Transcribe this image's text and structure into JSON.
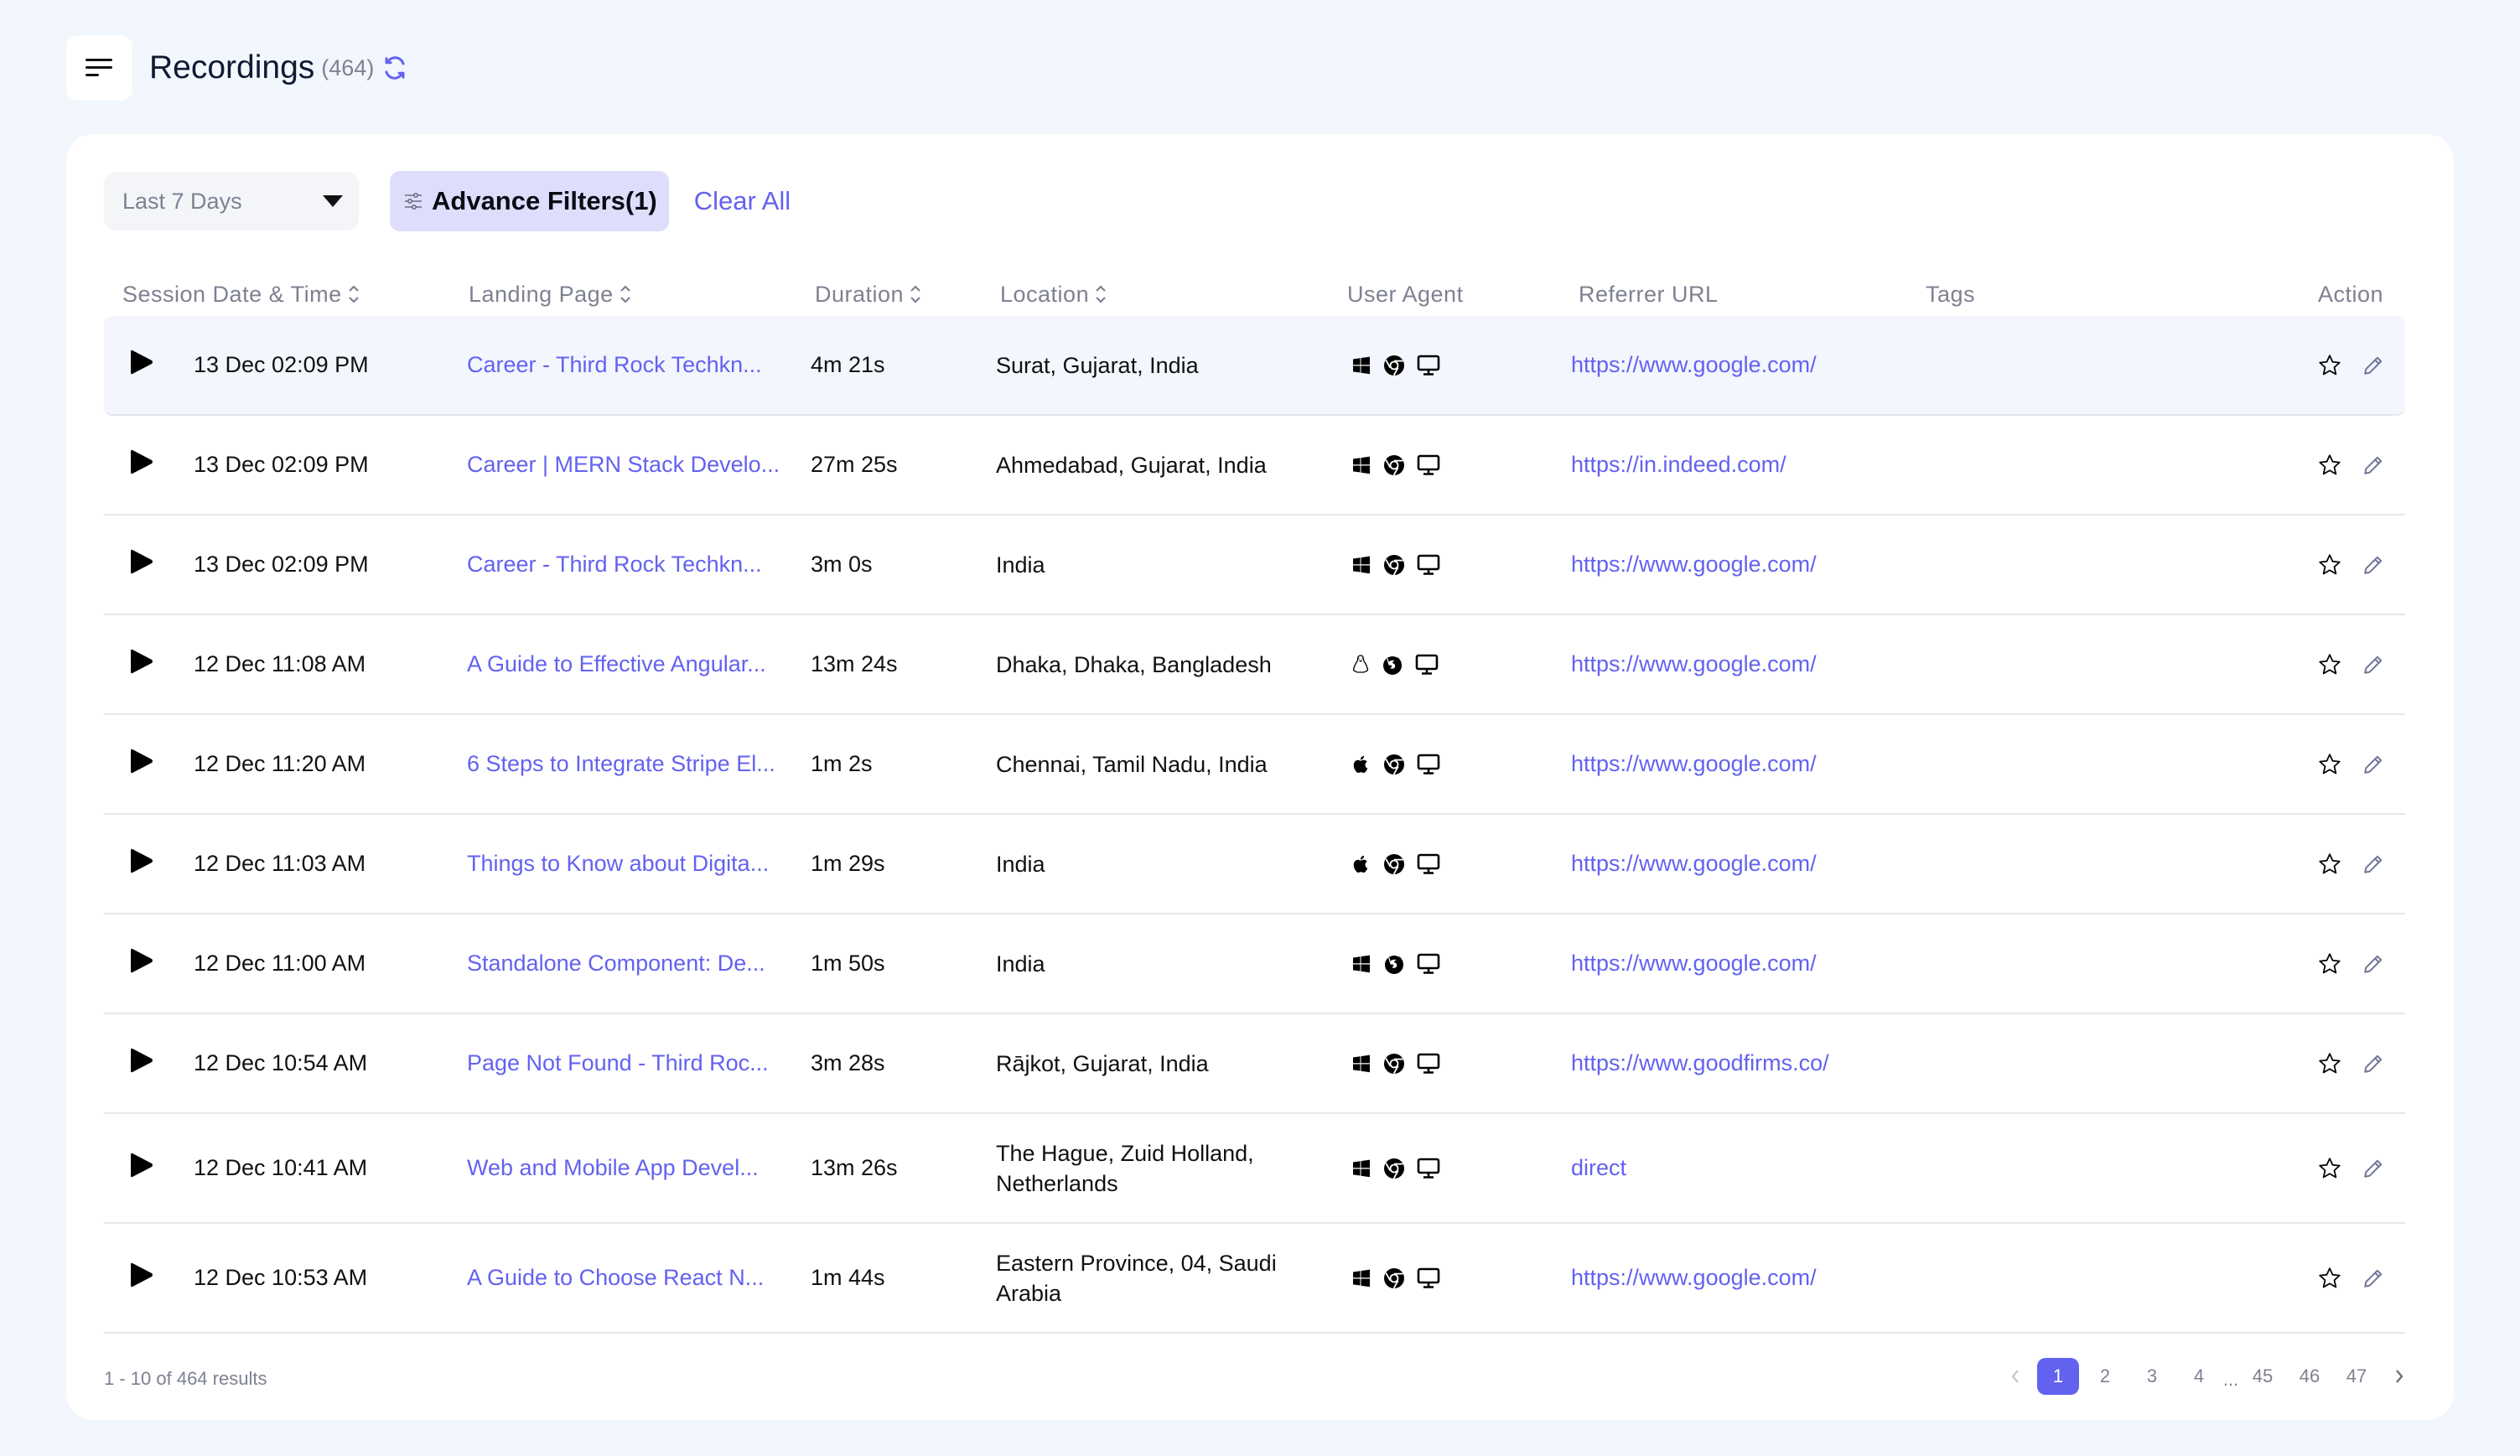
{
  "header": {
    "title": "Recordings",
    "count": "(464)"
  },
  "filters": {
    "date_range": "Last 7 Days",
    "advance_filters": "Advance Filters(1)",
    "clear_all": "Clear All"
  },
  "table": {
    "columns": [
      {
        "label": "Session Date & Time",
        "sortable": true
      },
      {
        "label": "Landing Page",
        "sortable": true
      },
      {
        "label": "Duration",
        "sortable": true
      },
      {
        "label": "Location",
        "sortable": true
      },
      {
        "label": "User Agent",
        "sortable": false
      },
      {
        "label": "Referrer URL",
        "sortable": false
      },
      {
        "label": "Tags",
        "sortable": false
      },
      {
        "label": "Action",
        "sortable": false
      }
    ],
    "rows": [
      {
        "date": "13 Dec 02:09 PM",
        "landing": "Career - Third Rock Techkn...",
        "duration": "4m 21s",
        "location": "Surat, Gujarat, India",
        "os": "windows",
        "browser": "chrome",
        "device": "desktop",
        "referrer": "https://www.google.com/"
      },
      {
        "date": "13 Dec 02:09 PM",
        "landing": "Career | MERN Stack Develo...",
        "duration": "27m 25s",
        "location": "Ahmedabad, Gujarat, India",
        "os": "windows",
        "browser": "chrome",
        "device": "desktop",
        "referrer": "https://in.indeed.com/"
      },
      {
        "date": "13 Dec 02:09 PM",
        "landing": "Career - Third Rock Techkn...",
        "duration": "3m 0s",
        "location": "India",
        "os": "windows",
        "browser": "chrome",
        "device": "desktop",
        "referrer": "https://www.google.com/"
      },
      {
        "date": "12 Dec 11:08 AM",
        "landing": "A Guide to Effective Angular...",
        "duration": "13m 24s",
        "location": "Dhaka, Dhaka, Bangladesh",
        "os": "linux",
        "browser": "firefox",
        "device": "desktop",
        "referrer": "https://www.google.com/"
      },
      {
        "date": "12 Dec 11:20 AM",
        "landing": "6 Steps to Integrate Stripe El...",
        "duration": "1m 2s",
        "location": "Chennai, Tamil Nadu, India",
        "os": "apple",
        "browser": "chrome",
        "device": "desktop",
        "referrer": "https://www.google.com/"
      },
      {
        "date": "12 Dec 11:03 AM",
        "landing": "Things to Know about Digita...",
        "duration": "1m 29s",
        "location": "India",
        "os": "apple",
        "browser": "chrome",
        "device": "desktop",
        "referrer": "https://www.google.com/"
      },
      {
        "date": "12 Dec 11:00 AM",
        "landing": "Standalone Component: De...",
        "duration": "1m 50s",
        "location": "India",
        "os": "windows",
        "browser": "firefox",
        "device": "desktop",
        "referrer": "https://www.google.com/"
      },
      {
        "date": "12 Dec 10:54 AM",
        "landing": "Page Not Found - Third Roc...",
        "duration": "3m 28s",
        "location": "Rājkot, Gujarat, India",
        "os": "windows",
        "browser": "chrome",
        "device": "desktop",
        "referrer": "https://www.goodfirms.co/"
      },
      {
        "date": "12 Dec 10:41 AM",
        "landing": "Web and Mobile App Devel...",
        "duration": "13m 26s",
        "location": "The Hague, Zuid Holland, Netherlands",
        "os": "windows",
        "browser": "chrome",
        "device": "desktop",
        "referrer": "direct"
      },
      {
        "date": "12 Dec 10:53 AM",
        "landing": "A Guide to Choose React N...",
        "duration": "1m 44s",
        "location": "Eastern Province, 04, Saudi Arabia",
        "os": "windows",
        "browser": "chrome",
        "device": "desktop",
        "referrer": "https://www.google.com/"
      }
    ]
  },
  "footer": {
    "results": "1 - 10 of 464 results",
    "pages": [
      "1",
      "2",
      "3",
      "4",
      "...",
      "45",
      "46",
      "47"
    ],
    "current_page": "1"
  },
  "colors": {
    "accent": "#6362f0",
    "background": "#f2f6fd",
    "muted_text": "#7e8192",
    "filter_active_bg": "#dedefc"
  }
}
